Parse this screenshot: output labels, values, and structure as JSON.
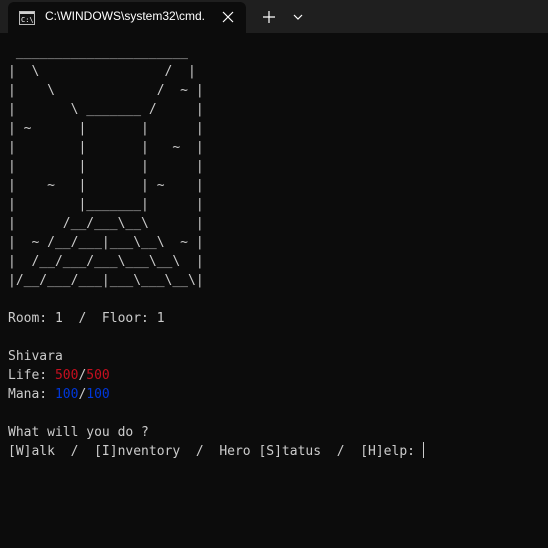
{
  "tab": {
    "title": "C:\\WINDOWS\\system32\\cmd.",
    "icon": "cmd-prompt-icon"
  },
  "titlebar": {
    "close_icon": "close-icon",
    "new_tab_icon": "plus-icon",
    "dropdown_icon": "chevron-down-icon"
  },
  "console": {
    "ascii_art": " ______________________\n|  \\                /  |\n|    \\             /  ~ |\n|       \\ _______ /     |\n| ~      |       |      |\n|        |       |   ~  |\n|        |       |      |\n|    ~   |       | ~    |\n|        |_______|      |\n|      /__/___\\__\\      |\n|  ~ /__/___|___\\__\\  ~ |\n|  /__/___/___\\___\\__\\  |\n|/__/___/___|___\\___\\__\\|",
    "room_line": "Room: 1  /  Floor: 1",
    "hero_name": "Shivara",
    "life": {
      "label": "Life: ",
      "current": "500",
      "separator": "/",
      "max": "500",
      "color": "#c50f1f"
    },
    "mana": {
      "label": "Mana: ",
      "current": "100",
      "separator": "/",
      "max": "100",
      "color": "#0037da"
    },
    "question": "What will you do ?",
    "options_line": "[W]alk  /  [I]nventory  /  Hero [S]tatus  /  [H]elp: "
  },
  "colors": {
    "background": "#0c0c0c",
    "titlebar": "#1f1f1f",
    "text": "#cccccc"
  }
}
